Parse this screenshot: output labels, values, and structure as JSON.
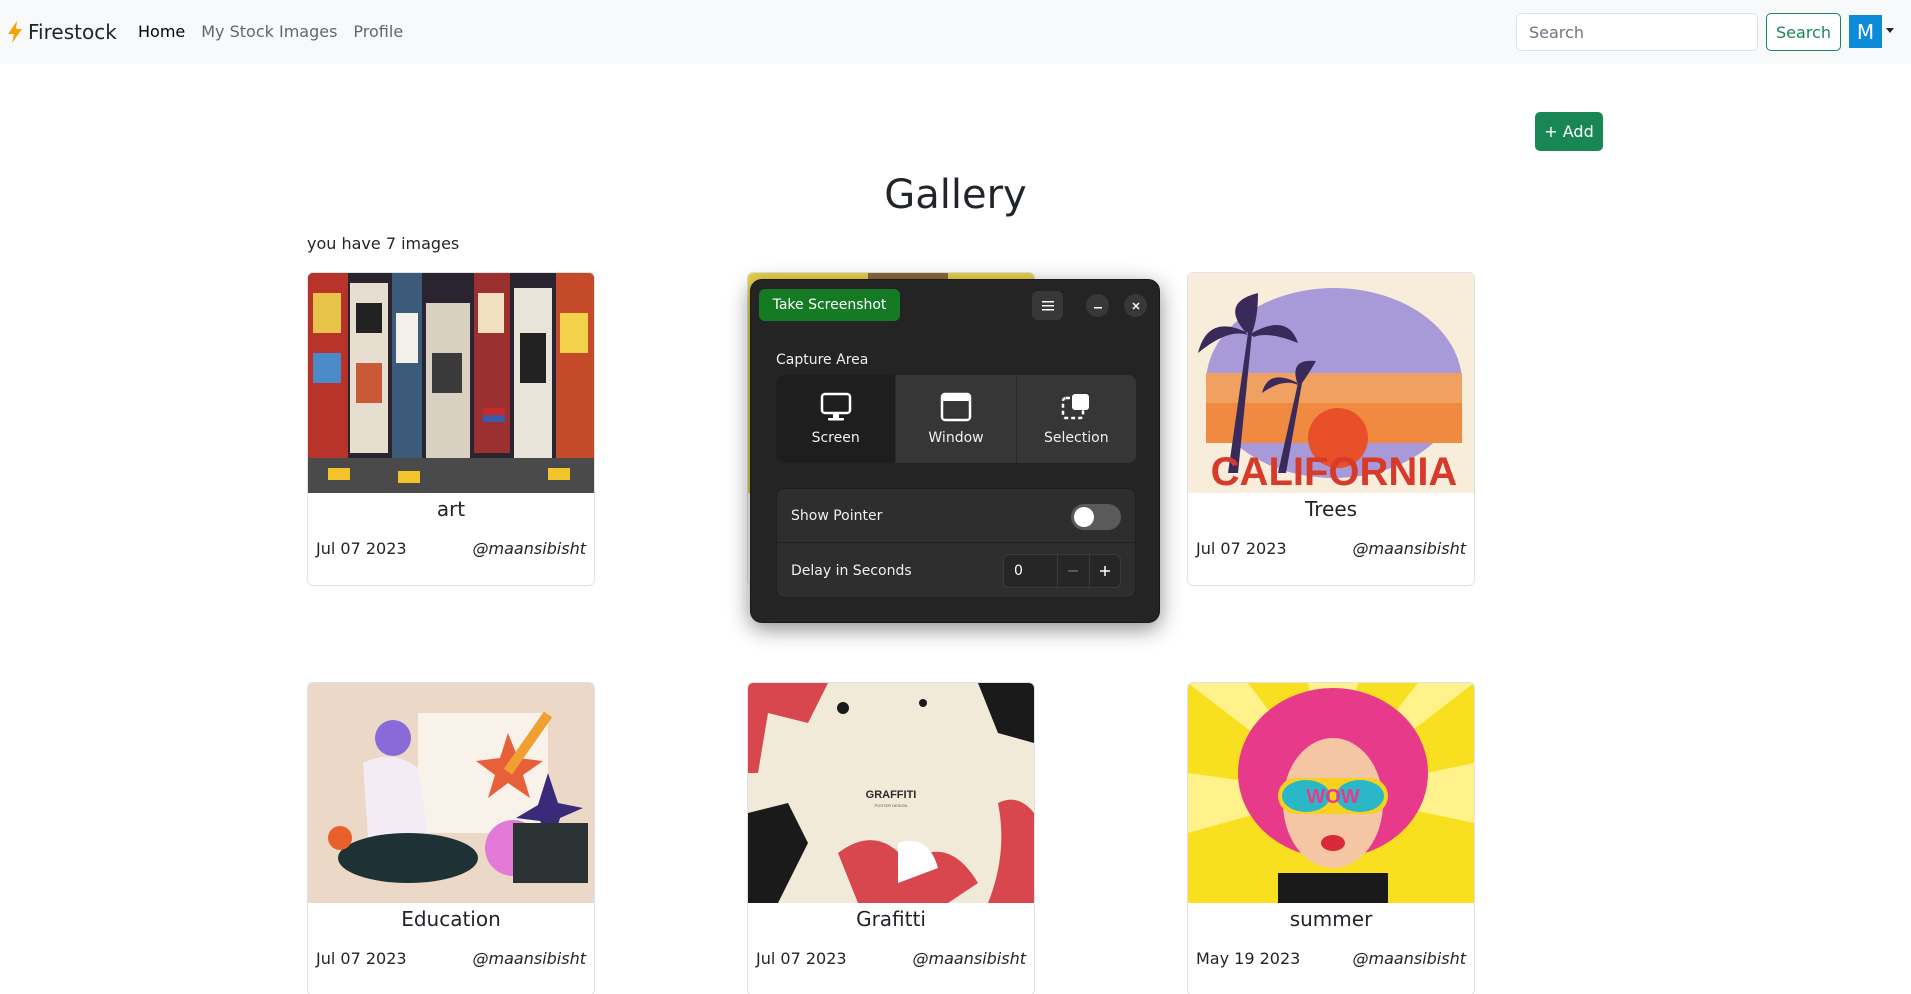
{
  "navbar": {
    "brand": "Firestock",
    "links": [
      {
        "label": "Home",
        "active": true
      },
      {
        "label": "My Stock Images",
        "active": false
      },
      {
        "label": "Profile",
        "active": false
      }
    ],
    "search_placeholder": "Search",
    "search_button": "Search",
    "avatar_initial": "M"
  },
  "add_button": "+ Add",
  "page_title": "Gallery",
  "image_count_text": "you have 7 images",
  "cards": [
    {
      "title": "art",
      "date": "Jul 07 2023",
      "user": "@maansibisht"
    },
    {
      "title": "",
      "date": "",
      "user": ""
    },
    {
      "title": "Trees",
      "date": "Jul 07 2023",
      "user": "@maansibisht"
    },
    {
      "title": "Education",
      "date": "Jul 07 2023",
      "user": "@maansibisht"
    },
    {
      "title": "Grafitti",
      "date": "Jul 07 2023",
      "user": "@maansibisht"
    },
    {
      "title": "summer",
      "date": "May 19 2023",
      "user": "@maansibisht"
    }
  ],
  "card_art_text": {
    "trees": "CALIFORNIA",
    "grafitti": "GRAFFITI",
    "grafitti_sub": "POSTER DESIGN",
    "summer": "WOW"
  },
  "screenshot_dialog": {
    "take_button": "Take Screenshot",
    "capture_area_label": "Capture Area",
    "options": [
      {
        "label": "Screen",
        "icon": "monitor-icon",
        "selected": true
      },
      {
        "label": "Window",
        "icon": "window-icon",
        "selected": false
      },
      {
        "label": "Selection",
        "icon": "selection-icon",
        "selected": false
      }
    ],
    "show_pointer_label": "Show Pointer",
    "show_pointer_on": false,
    "delay_label": "Delay in Seconds",
    "delay_value": "0"
  },
  "colors": {
    "success": "#198754",
    "avatar_bg": "#0d8ad8",
    "dialog_bg": "#242424",
    "take_button_bg": "#157a24"
  }
}
